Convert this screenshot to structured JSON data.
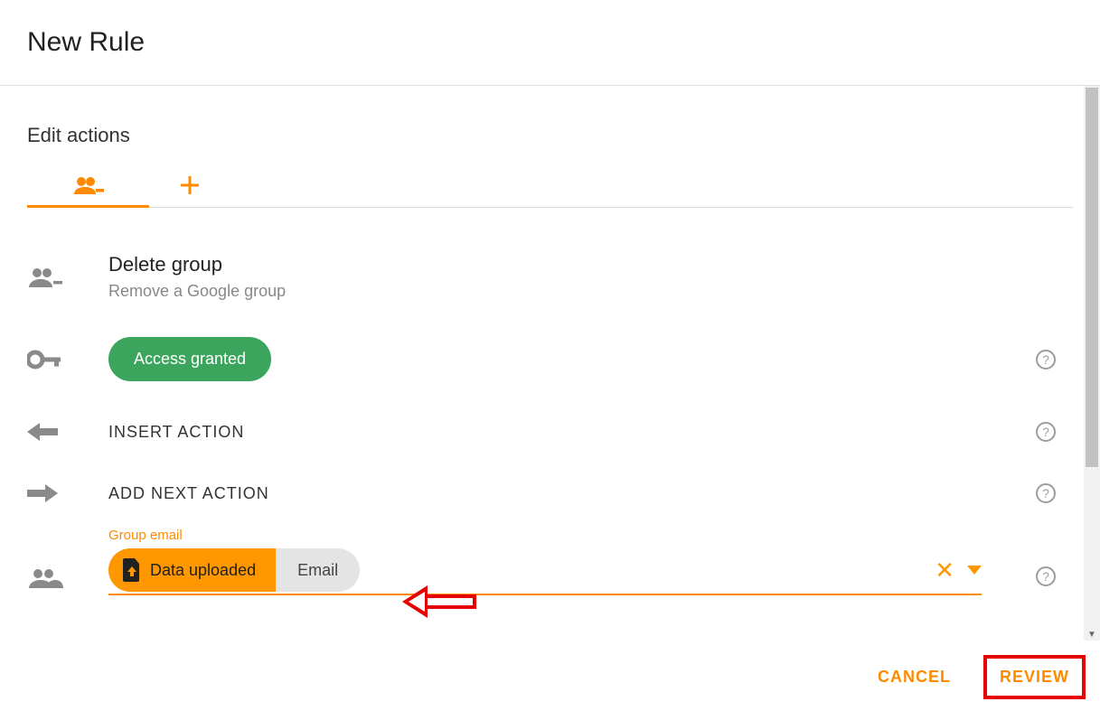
{
  "page_title": "New Rule",
  "section_title": "Edit actions",
  "delete_group": {
    "title": "Delete group",
    "subtitle": "Remove a Google group"
  },
  "access_status_label": "Access granted",
  "insert_action_label": "INSERT ACTION",
  "add_next_action_label": "ADD NEXT ACTION",
  "group_email": {
    "field_label": "Group email",
    "chip_label": "Data uploaded",
    "chip_suffix": "Email"
  },
  "footer": {
    "cancel_label": "CANCEL",
    "review_label": "REVIEW"
  }
}
